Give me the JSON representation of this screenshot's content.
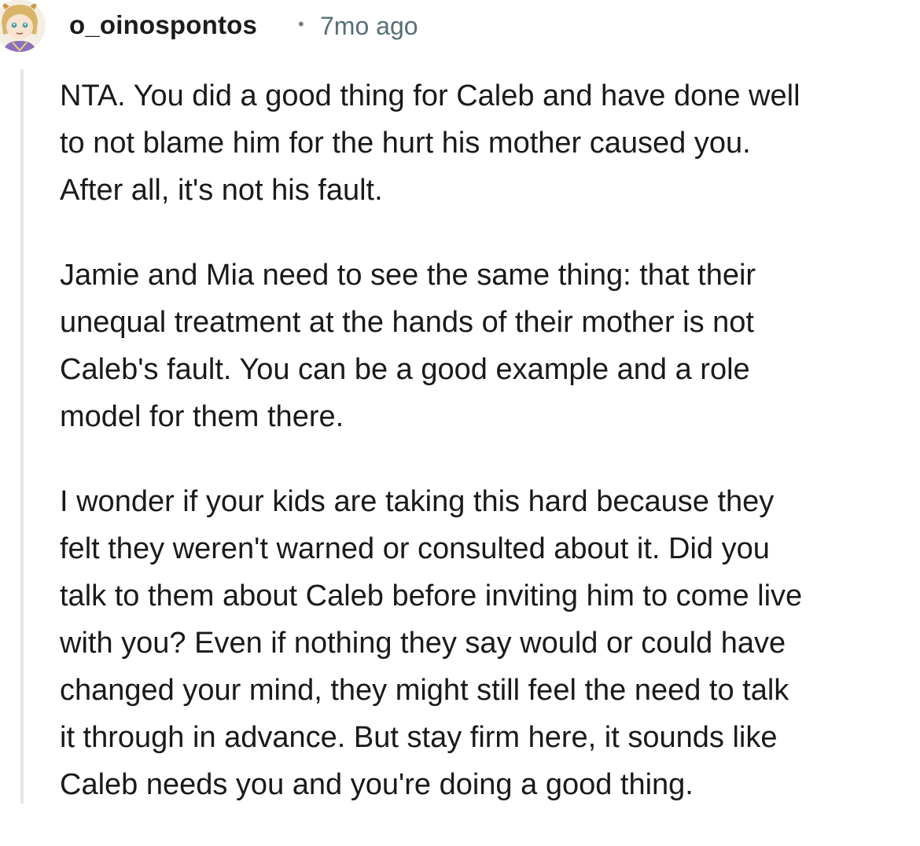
{
  "comment": {
    "author": "o_oinospontos",
    "separator": "•",
    "timestamp": "7mo ago",
    "paragraphs": [
      {
        "lines": [
          "NTA. You did a good thing for Caleb and have done well",
          "to not blame him for the hurt his mother caused you.",
          "After all, it's not his fault."
        ]
      },
      {
        "lines": [
          "Jamie and Mia need to see the same thing: that their",
          "unequal treatment at the hands of their mother is not",
          "Caleb's fault. You can be a good example and a role",
          "model for them there."
        ]
      },
      {
        "lines": [
          "I wonder if your kids are taking this hard because they",
          "felt they weren't warned or consulted about it. Did you",
          "talk to them about Caleb before inviting him to come live",
          "with you? Even if nothing they say would or could have",
          "changed your mind, they might still feel the need to talk",
          "it through in advance. But stay firm here, it sounds like",
          "Caleb needs you and you're doing a good thing."
        ]
      }
    ]
  },
  "icons": {
    "avatar": "user-avatar-icon"
  },
  "colors": {
    "text": "#1a1a1b",
    "meta": "#576f76",
    "thread_line": "#e3e6e8"
  }
}
